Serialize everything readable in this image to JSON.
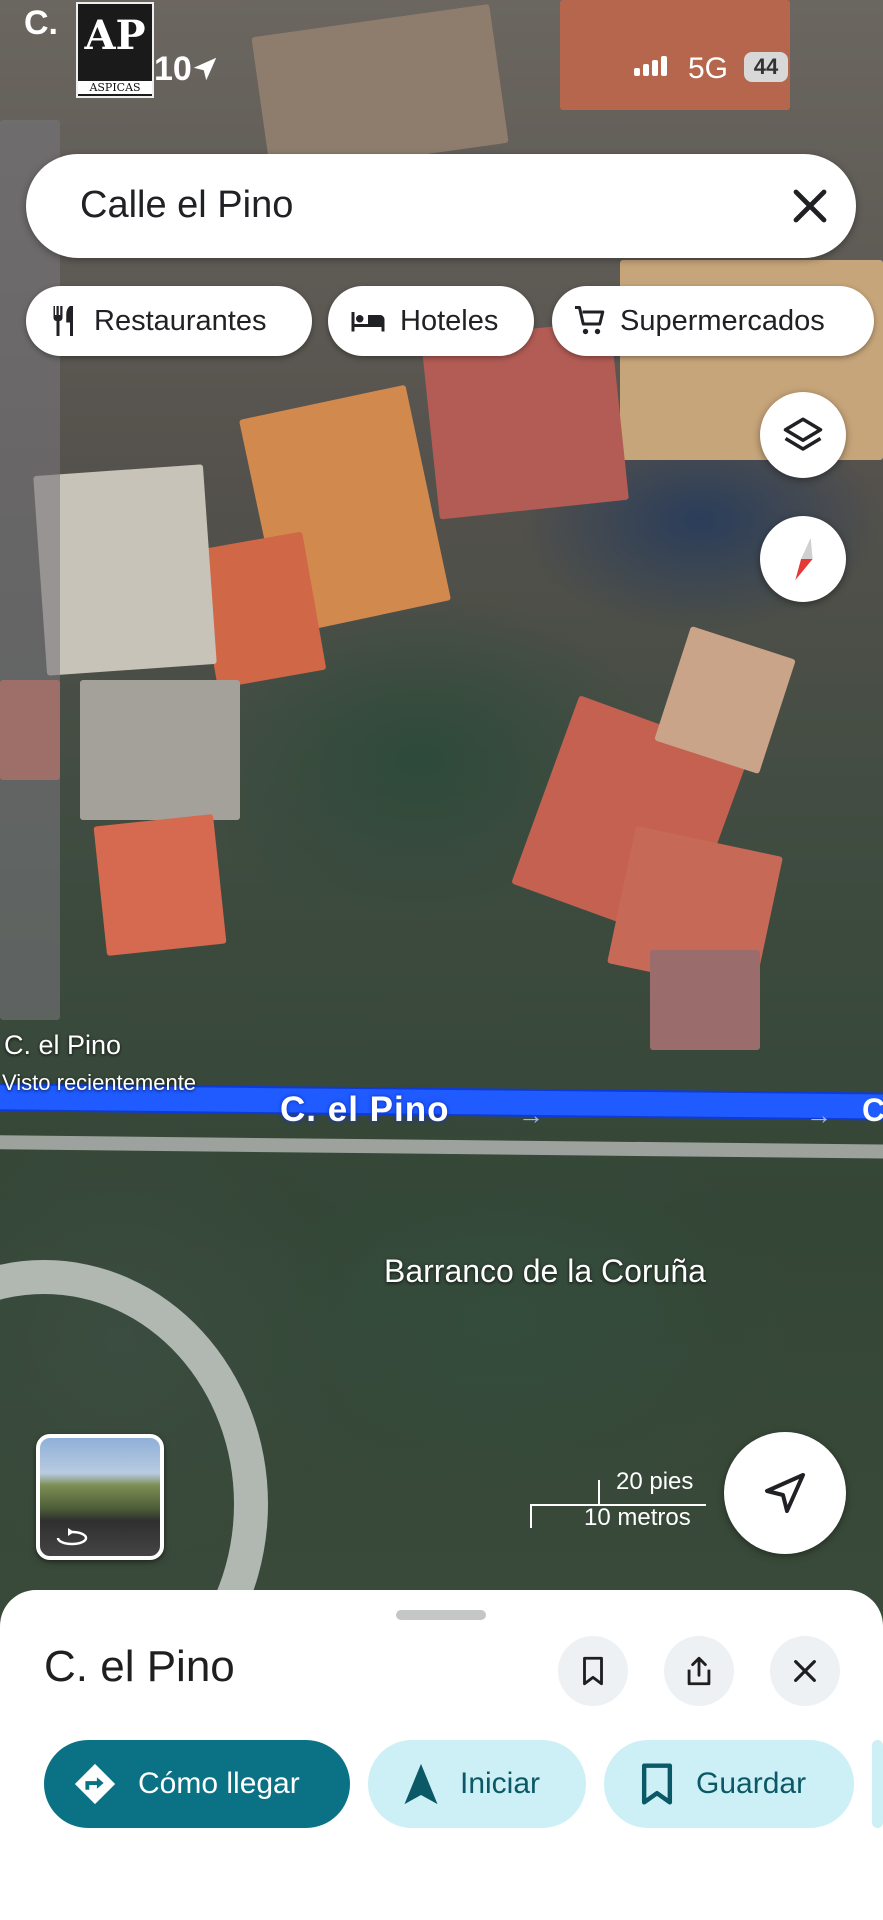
{
  "status_bar": {
    "carrier_fragment": "C.",
    "time_fragment": "10",
    "network": "5G",
    "battery": "44"
  },
  "watermark": {
    "monogram": "AP",
    "name": "ASPICAS"
  },
  "search": {
    "query": "Calle el Pino"
  },
  "chips": [
    {
      "label": "Restaurantes",
      "icon": "fork-knife-icon"
    },
    {
      "label": "Hoteles",
      "icon": "bed-icon"
    },
    {
      "label": "Supermercados",
      "icon": "cart-icon"
    }
  ],
  "map": {
    "recent_place": "C. el Pino",
    "recent_sub": "Visto recientemente",
    "road_label": "C. el Pino",
    "road_end_fragment": "C",
    "area_label": "Barranco de la Coruña",
    "scale_imperial": "20 pies",
    "scale_metric": "10 metros"
  },
  "sheet": {
    "title": "C. el Pino",
    "actions": [
      {
        "label": "Cómo llegar",
        "icon": "directions-icon"
      },
      {
        "label": "Iniciar",
        "icon": "navigation-icon"
      },
      {
        "label": "Guardar",
        "icon": "bookmark-icon"
      }
    ]
  },
  "colors": {
    "route_blue": "#1f5bff",
    "primary_teal": "#0b7285",
    "tonal_bg": "#cdeff6",
    "tonal_text": "#0b5866"
  }
}
